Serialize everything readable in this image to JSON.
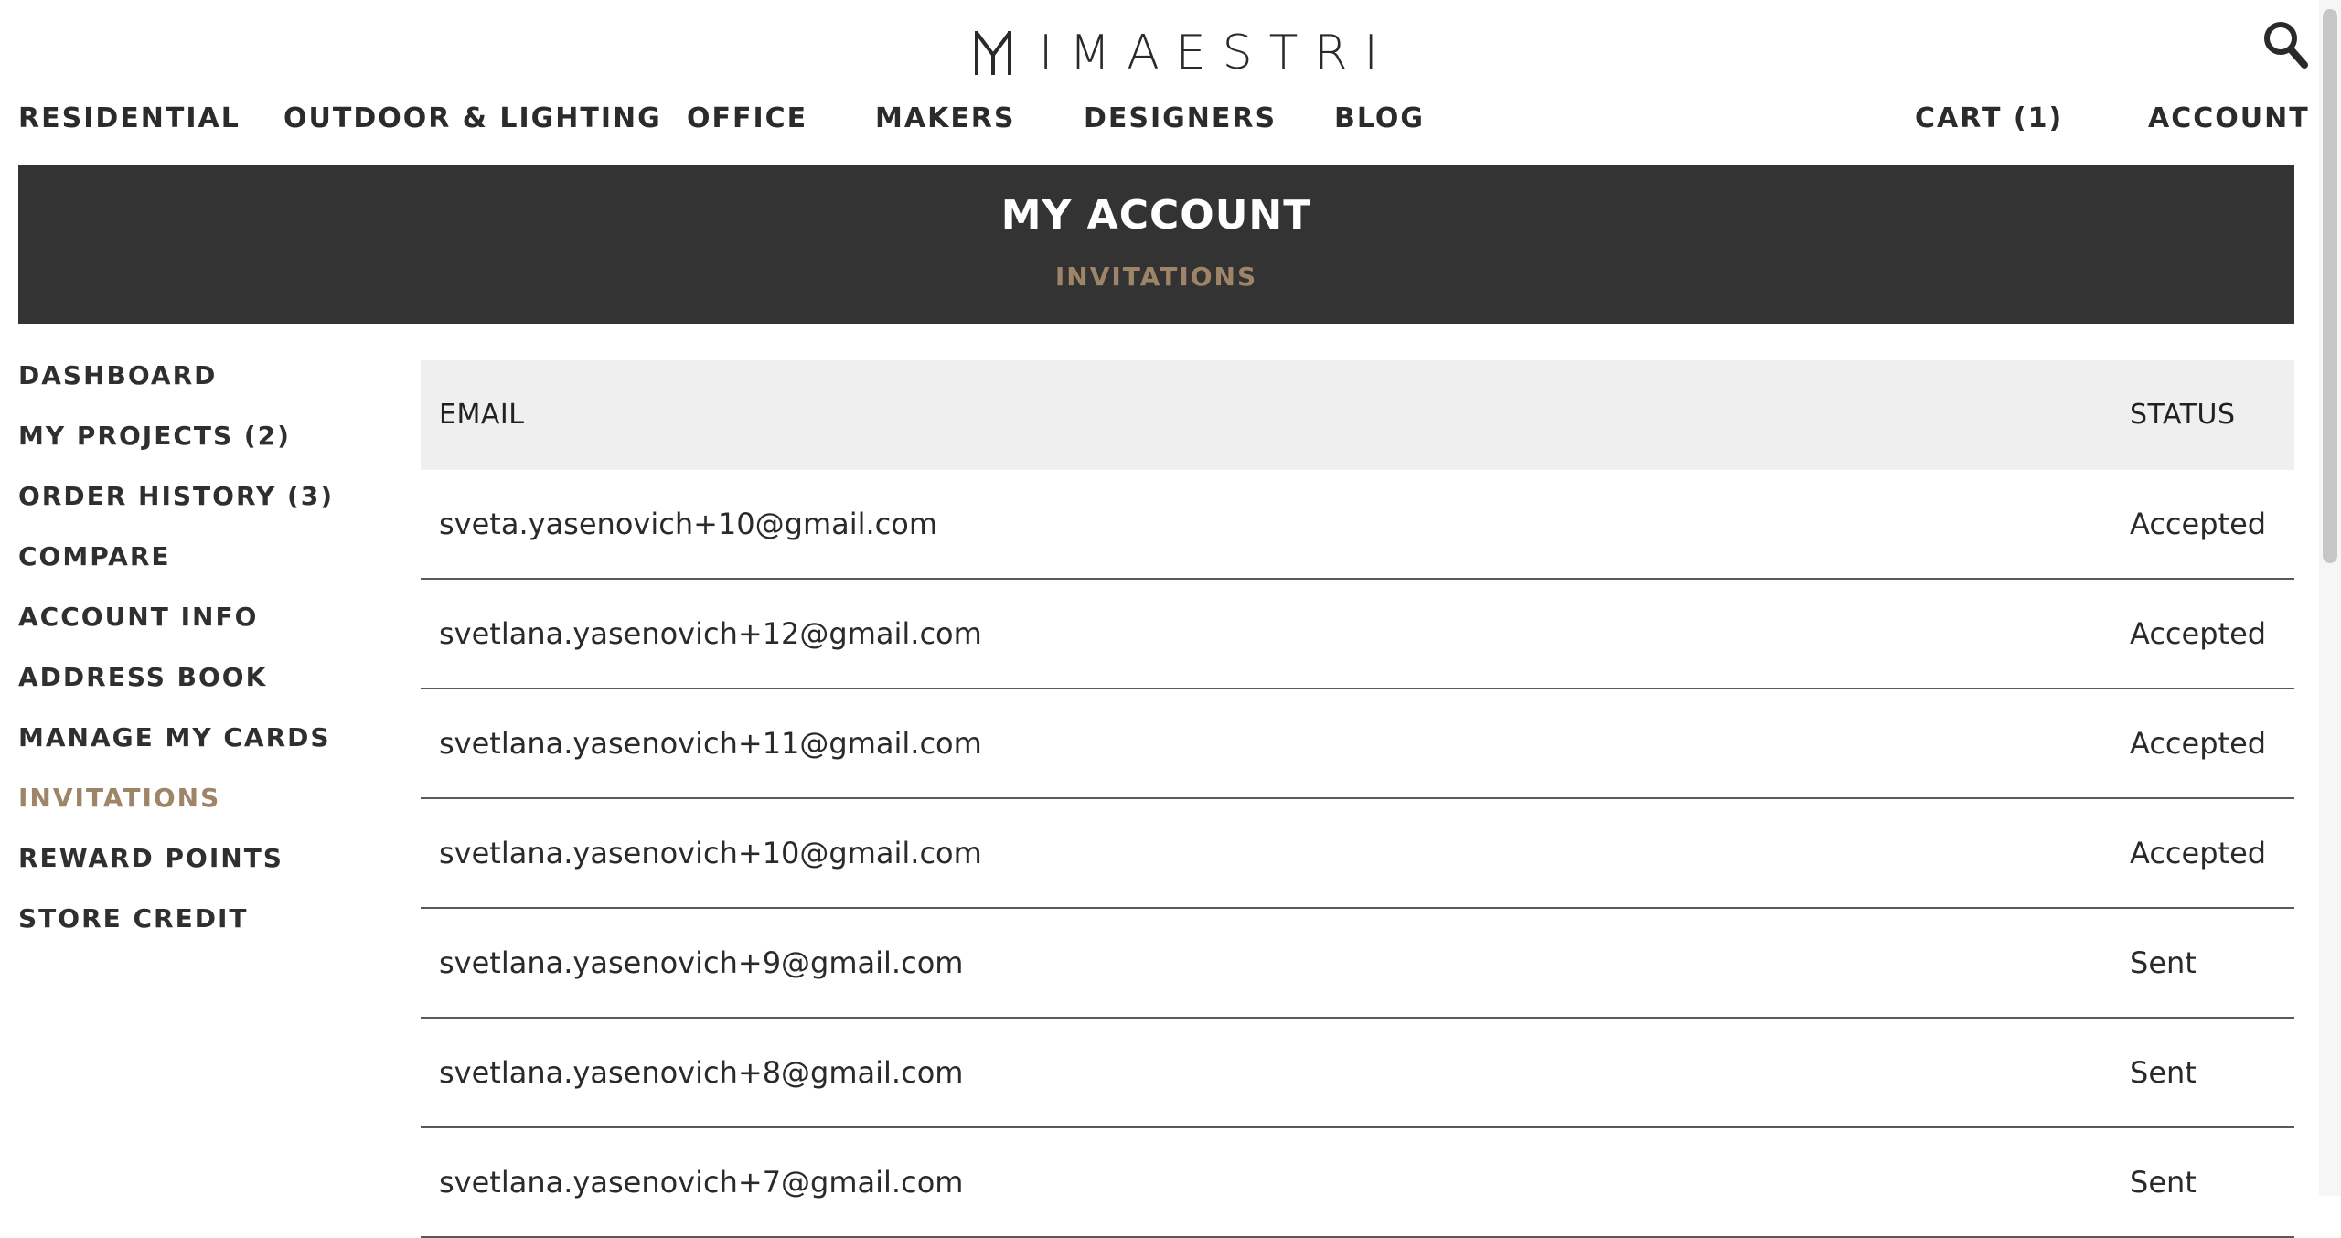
{
  "brand": {
    "name": "IMAESTRI"
  },
  "nav": {
    "left": [
      "RESIDENTIAL",
      "OUTDOOR & LIGHTING",
      "OFFICE",
      "MAKERS",
      "DESIGNERS",
      "BLOG"
    ],
    "cart": "CART (1)",
    "account": "ACCOUNT"
  },
  "banner": {
    "title": "MY ACCOUNT",
    "subtitle": "INVITATIONS"
  },
  "sidebar": {
    "items": [
      {
        "label": "DASHBOARD"
      },
      {
        "label": "MY PROJECTS (2)"
      },
      {
        "label": "ORDER HISTORY (3)"
      },
      {
        "label": "COMPARE"
      },
      {
        "label": "ACCOUNT INFO"
      },
      {
        "label": "ADDRESS BOOK"
      },
      {
        "label": "MANAGE MY CARDS"
      },
      {
        "label": "INVITATIONS"
      },
      {
        "label": "REWARD POINTS"
      },
      {
        "label": "STORE CREDIT"
      }
    ]
  },
  "invitations": {
    "columns": {
      "email": "EMAIL",
      "status": "STATUS"
    },
    "rows": [
      {
        "email": "sveta.yasenovich+10@gmail.com",
        "status": "Accepted"
      },
      {
        "email": "svetlana.yasenovich+12@gmail.com",
        "status": "Accepted"
      },
      {
        "email": "svetlana.yasenovich+11@gmail.com",
        "status": "Accepted"
      },
      {
        "email": "svetlana.yasenovich+10@gmail.com",
        "status": "Accepted"
      },
      {
        "email": "svetlana.yasenovich+9@gmail.com",
        "status": "Sent"
      },
      {
        "email": "svetlana.yasenovich+8@gmail.com",
        "status": "Sent"
      },
      {
        "email": "svetlana.yasenovich+7@gmail.com",
        "status": "Sent"
      }
    ]
  },
  "icons": {
    "search": "search-icon",
    "logo": "logo-mark-icon"
  },
  "colors": {
    "banner_bg": "#333333",
    "accent": "#9e8568",
    "header_row_bg": "#efefef"
  }
}
